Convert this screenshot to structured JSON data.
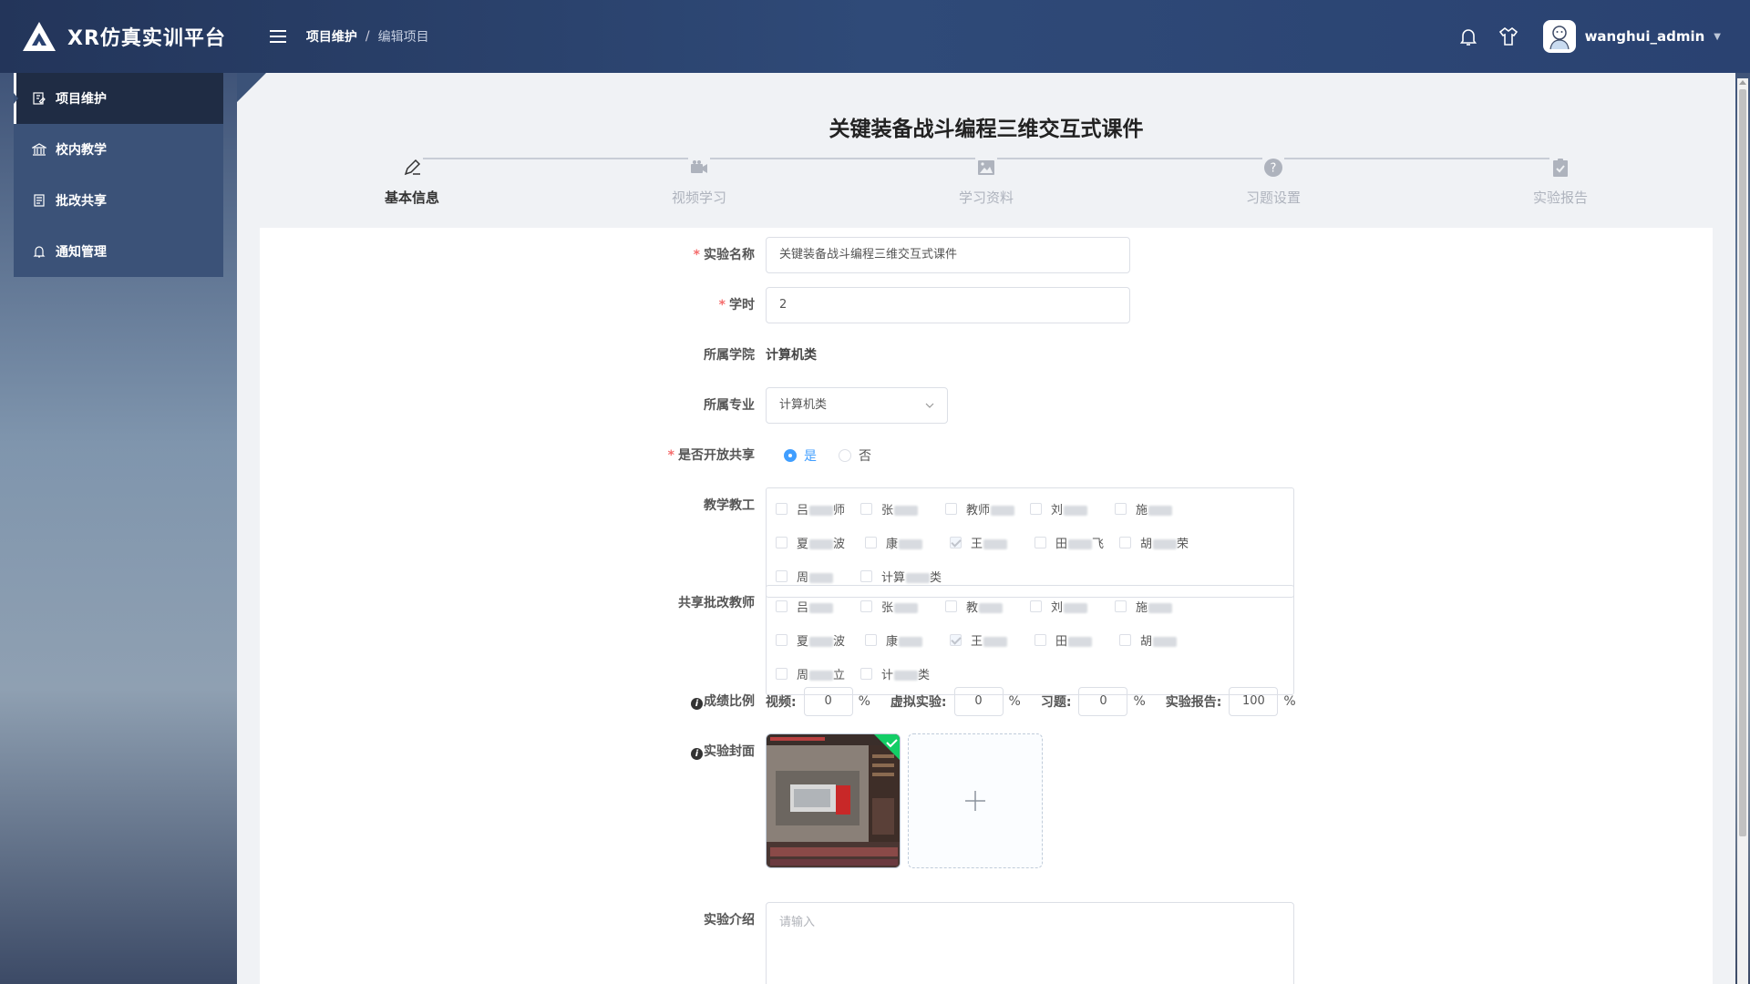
{
  "header": {
    "app_title": "XR仿真实训平台",
    "breadcrumb": {
      "parent": "项目维护",
      "separator": "/",
      "current": "编辑项目"
    },
    "username": "wanghui_admin"
  },
  "sidebar": {
    "items": [
      {
        "label": "项目维护",
        "icon": "edit-doc-icon",
        "active": true
      },
      {
        "label": "校内教学",
        "icon": "building-icon",
        "active": false
      },
      {
        "label": "批改共享",
        "icon": "paper-stack-icon",
        "active": false
      },
      {
        "label": "通知管理",
        "icon": "bell-icon",
        "active": false
      }
    ]
  },
  "page": {
    "title": "关键装备战斗编程三维交互式课件"
  },
  "steps": [
    {
      "label": "基本信息",
      "icon": "pencil-icon",
      "active": true
    },
    {
      "label": "视频学习",
      "icon": "video-icon",
      "active": false
    },
    {
      "label": "学习资料",
      "icon": "image-icon",
      "active": false
    },
    {
      "label": "习题设置",
      "icon": "question-icon",
      "active": false
    },
    {
      "label": "实验报告",
      "icon": "clipboard-icon",
      "active": false
    }
  ],
  "form": {
    "name": {
      "label": "实验名称",
      "value": "关键装备战斗编程三维交互式课件"
    },
    "hours": {
      "label": "学时",
      "value": "2"
    },
    "college": {
      "label": "所属学院",
      "value": "计算机类"
    },
    "major": {
      "label": "所属专业",
      "value": "计算机类"
    },
    "share": {
      "label": "是否开放共享",
      "yes": "是",
      "no": "否",
      "selected": "是"
    },
    "teachers": {
      "label": "教学教工",
      "options": [
        {
          "text": "吕",
          "tail": "师",
          "checked": false
        },
        {
          "text": "张",
          "tail": "",
          "checked": false
        },
        {
          "text": "教师",
          "tail": "",
          "checked": false
        },
        {
          "text": "刘",
          "tail": "",
          "checked": false
        },
        {
          "text": "施",
          "tail": "",
          "checked": false
        },
        {
          "text": "夏",
          "tail": "波",
          "checked": false
        },
        {
          "text": "康",
          "tail": "",
          "checked": false
        },
        {
          "text": "王",
          "tail": "",
          "checked": true
        },
        {
          "text": "田",
          "tail": "飞",
          "checked": false
        },
        {
          "text": "胡",
          "tail": "荣",
          "checked": false
        },
        {
          "text": "周",
          "tail": "",
          "checked": false
        },
        {
          "text": "计算",
          "tail": "类",
          "checked": false
        }
      ]
    },
    "reviewers": {
      "label": "共享批改教师",
      "options": [
        {
          "text": "吕",
          "tail": "",
          "checked": false
        },
        {
          "text": "张",
          "tail": "",
          "checked": false
        },
        {
          "text": "教",
          "tail": "",
          "checked": false
        },
        {
          "text": "刘",
          "tail": "",
          "checked": false
        },
        {
          "text": "施",
          "tail": "",
          "checked": false
        },
        {
          "text": "夏",
          "tail": "波",
          "checked": false
        },
        {
          "text": "康",
          "tail": "",
          "checked": false
        },
        {
          "text": "王",
          "tail": "",
          "checked": true
        },
        {
          "text": "田",
          "tail": "",
          "checked": false
        },
        {
          "text": "胡",
          "tail": "",
          "checked": false
        },
        {
          "text": "周",
          "tail": "立",
          "checked": false
        },
        {
          "text": "计",
          "tail": "类",
          "checked": false
        }
      ]
    },
    "score": {
      "label": "成绩比例",
      "video_label": "视频:",
      "video": "0",
      "virtual_label": "虚拟实验:",
      "virtual": "0",
      "exercise_label": "习题:",
      "exercise": "0",
      "report_label": "实验报告:",
      "report": "100",
      "unit": "%"
    },
    "cover": {
      "label": "实验封面"
    },
    "intro": {
      "label": "实验介绍",
      "placeholder": "请输入"
    }
  },
  "colors": {
    "primary": "#409eff",
    "required": "#f56c6c",
    "sidebar_active": "#1f2c44"
  }
}
